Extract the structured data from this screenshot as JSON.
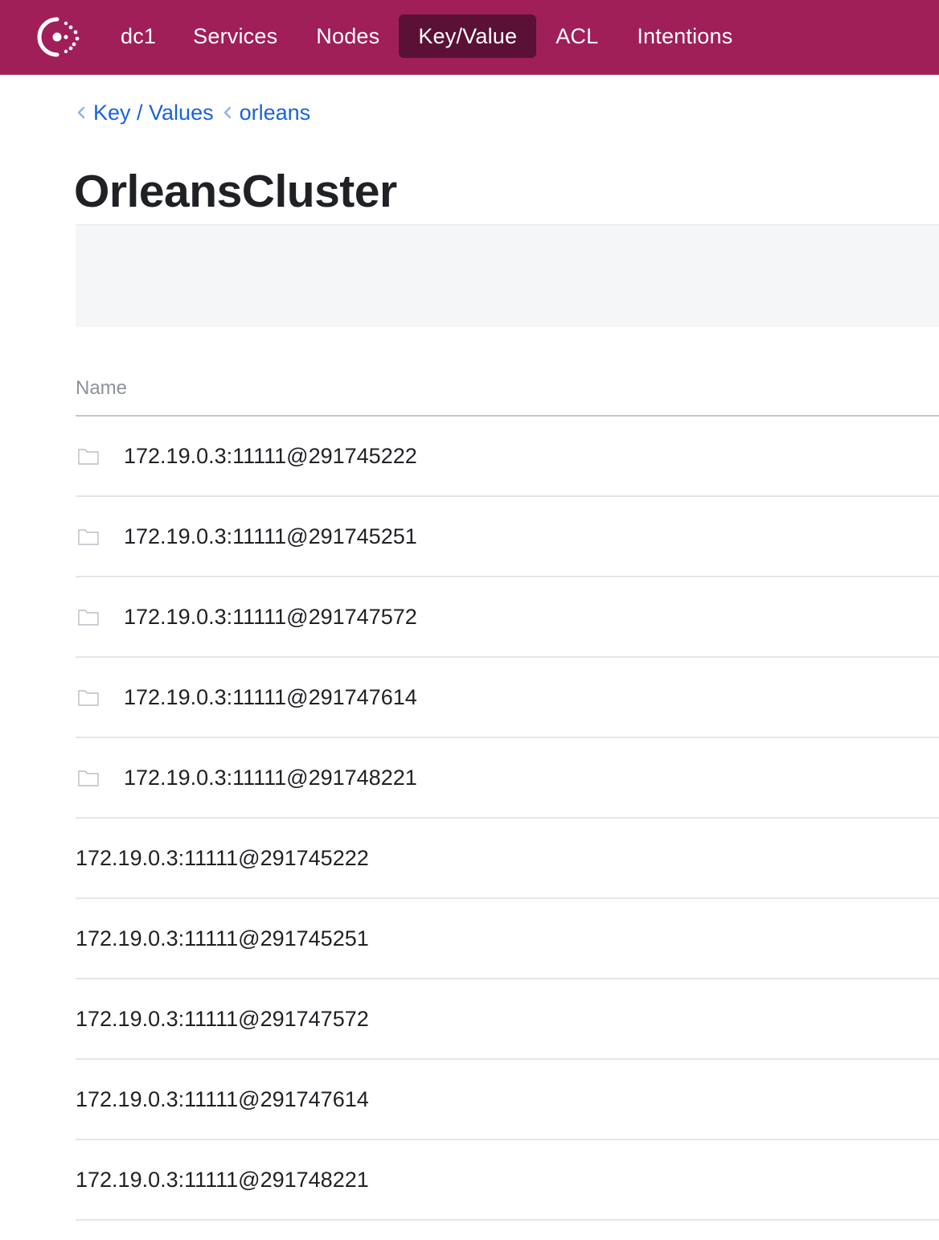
{
  "nav": {
    "logo_icon": "consul-logo-icon",
    "datacenter": "dc1",
    "items": [
      {
        "label": "Services"
      },
      {
        "label": "Nodes"
      },
      {
        "label": "Key/Value",
        "active": true
      },
      {
        "label": "ACL"
      },
      {
        "label": "Intentions"
      }
    ]
  },
  "breadcrumb": [
    {
      "label": "Key / Values"
    },
    {
      "label": "orleans"
    }
  ],
  "page": {
    "title": "OrleansCluster"
  },
  "table": {
    "header_name": "Name",
    "folders": [
      {
        "name": "172.19.0.3:11111@291745222"
      },
      {
        "name": "172.19.0.3:11111@291745251"
      },
      {
        "name": "172.19.0.3:11111@291747572"
      },
      {
        "name": "172.19.0.3:11111@291747614"
      },
      {
        "name": "172.19.0.3:11111@291748221"
      }
    ],
    "keys": [
      {
        "name": "172.19.0.3:11111@291745222"
      },
      {
        "name": "172.19.0.3:11111@291745251"
      },
      {
        "name": "172.19.0.3:11111@291747572"
      },
      {
        "name": "172.19.0.3:11111@291747614"
      },
      {
        "name": "172.19.0.3:11111@291748221"
      }
    ]
  },
  "colors": {
    "brand": "#a01f59",
    "nav_active": "#5a1135",
    "link": "#1a63d8"
  }
}
